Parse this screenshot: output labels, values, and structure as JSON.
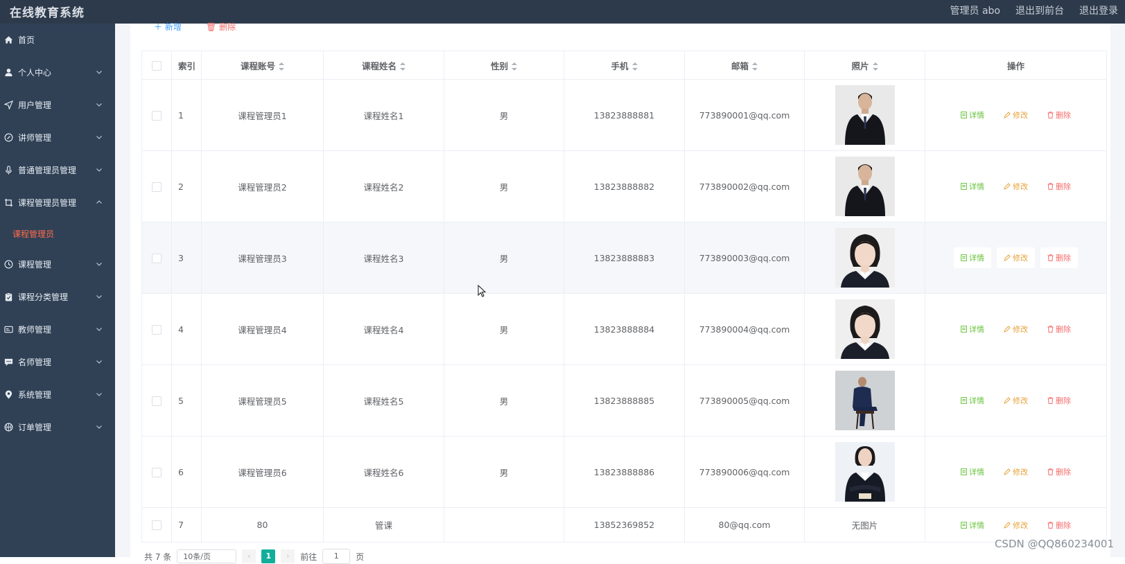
{
  "header": {
    "app_title": "在线教育系统",
    "admin_label": "管理员 abo",
    "to_front_label": "退出到前台",
    "logout_label": "退出登录"
  },
  "sidebar": {
    "items": [
      {
        "label": "首页",
        "icon": "home-icon",
        "expandable": false
      },
      {
        "label": "个人中心",
        "icon": "user-icon",
        "expandable": true
      },
      {
        "label": "用户管理",
        "icon": "send-icon",
        "expandable": true
      },
      {
        "label": "讲师管理",
        "icon": "compass-icon",
        "expandable": true
      },
      {
        "label": "普通管理员管理",
        "icon": "microphone-icon",
        "expandable": true
      },
      {
        "label": "课程管理员管理",
        "icon": "crop-icon",
        "expandable": true,
        "expanded": true
      },
      {
        "label": "课程管理员",
        "sub": true,
        "active": true
      },
      {
        "label": "课程管理",
        "icon": "clock-icon",
        "expandable": true
      },
      {
        "label": "课程分类管理",
        "icon": "clipboard-icon",
        "expandable": true
      },
      {
        "label": "教师管理",
        "icon": "id-card-icon",
        "expandable": true
      },
      {
        "label": "名师管理",
        "icon": "chat-icon",
        "expandable": true
      },
      {
        "label": "系统管理",
        "icon": "location-icon",
        "expandable": true
      },
      {
        "label": "订单管理",
        "icon": "basketball-icon",
        "expandable": true
      }
    ]
  },
  "toolbar": {
    "add_label": "新增",
    "delete_label": "删除"
  },
  "table": {
    "headers": {
      "index": "索引",
      "account": "课程账号",
      "name": "课程姓名",
      "gender": "性别",
      "phone": "手机",
      "email": "邮箱",
      "photo": "照片",
      "actions": "操作"
    },
    "rows": [
      {
        "index": "1",
        "account": "课程管理员1",
        "name": "课程姓名1",
        "gender": "男",
        "phone": "13823888881",
        "email": "773890001@qq.com",
        "photo": "man-in-suit"
      },
      {
        "index": "2",
        "account": "课程管理员2",
        "name": "课程姓名2",
        "gender": "男",
        "phone": "13823888882",
        "email": "773890002@qq.com",
        "photo": "man-in-suit"
      },
      {
        "index": "3",
        "account": "课程管理员3",
        "name": "课程姓名3",
        "gender": "男",
        "phone": "13823888883",
        "email": "773890003@qq.com",
        "photo": "woman-portrait"
      },
      {
        "index": "4",
        "account": "课程管理员4",
        "name": "课程姓名4",
        "gender": "男",
        "phone": "13823888884",
        "email": "773890004@qq.com",
        "photo": "woman-portrait"
      },
      {
        "index": "5",
        "account": "课程管理员5",
        "name": "课程姓名5",
        "gender": "男",
        "phone": "13823888885",
        "email": "773890005@qq.com",
        "photo": "man-seated"
      },
      {
        "index": "6",
        "account": "课程管理员6",
        "name": "课程姓名6",
        "gender": "男",
        "phone": "13823888886",
        "email": "773890006@qq.com",
        "photo": "woman-arms-crossed"
      },
      {
        "index": "7",
        "account": "80",
        "name": "管课",
        "gender": "",
        "phone": "13852369852",
        "email": "80@qq.com",
        "photo_text": "无图片"
      }
    ],
    "action_labels": {
      "detail": "详情",
      "edit": "修改",
      "delete": "删除"
    }
  },
  "pagination": {
    "total_label": "共 7 条",
    "page_size_label": "10条/页",
    "current_page": "1",
    "goto_label": "前往",
    "goto_value": "1",
    "page_unit": "页"
  },
  "watermark": "CSDN @QQ860234001"
}
